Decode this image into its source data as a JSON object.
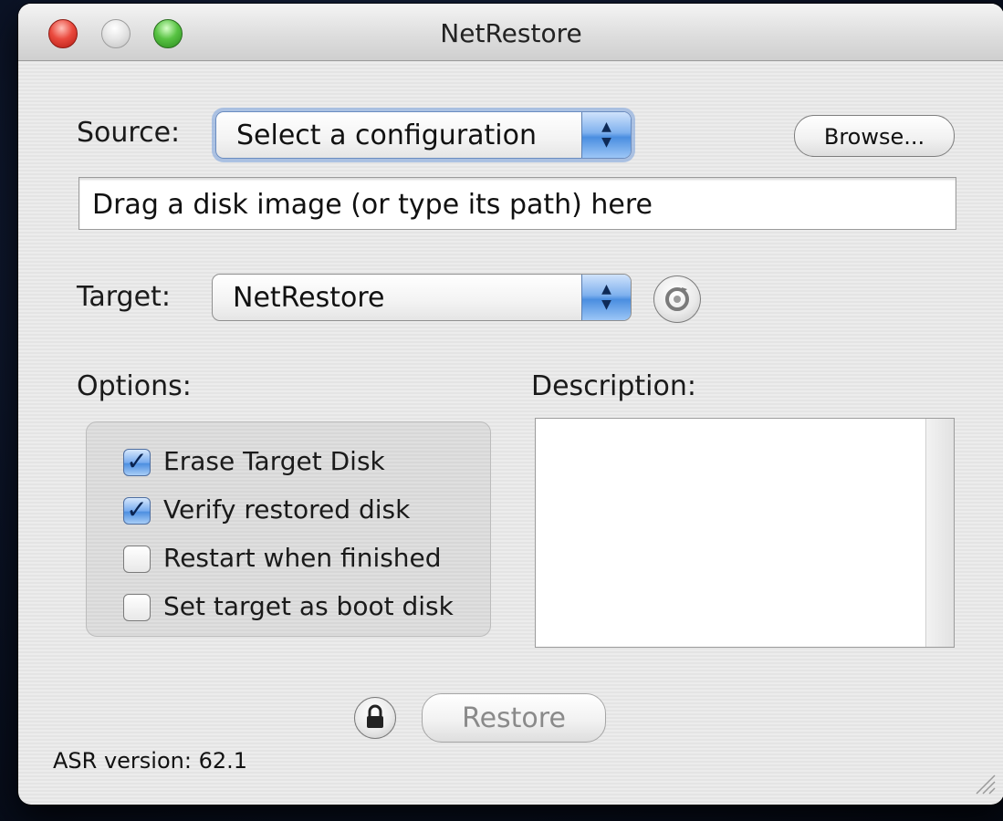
{
  "window": {
    "title": "NetRestore"
  },
  "source": {
    "label": "Source:",
    "popup_value": "Select a configuration",
    "browse_label": "Browse...",
    "path_field_value": "Drag a disk image (or type its path) here"
  },
  "target": {
    "label": "Target:",
    "popup_value": "NetRestore"
  },
  "options": {
    "label": "Options:",
    "items": [
      {
        "label": "Erase Target Disk",
        "checked": true
      },
      {
        "label": "Verify restored disk",
        "checked": true
      },
      {
        "label": "Restart when finished",
        "checked": false
      },
      {
        "label": "Set target as boot disk",
        "checked": false
      }
    ]
  },
  "description": {
    "label": "Description:",
    "value": ""
  },
  "footer": {
    "restore_label": "Restore",
    "version_text": "ASR version: 62.1"
  },
  "icons": {
    "refresh": "refresh-icon",
    "lock": "lock-icon",
    "popup_arrows": "updown-arrows-icon",
    "resize": "resize-grip-icon"
  },
  "colors": {
    "accent_blue": "#4a8ee0",
    "close_red": "#ea4a3e",
    "zoom_green": "#58c343"
  }
}
